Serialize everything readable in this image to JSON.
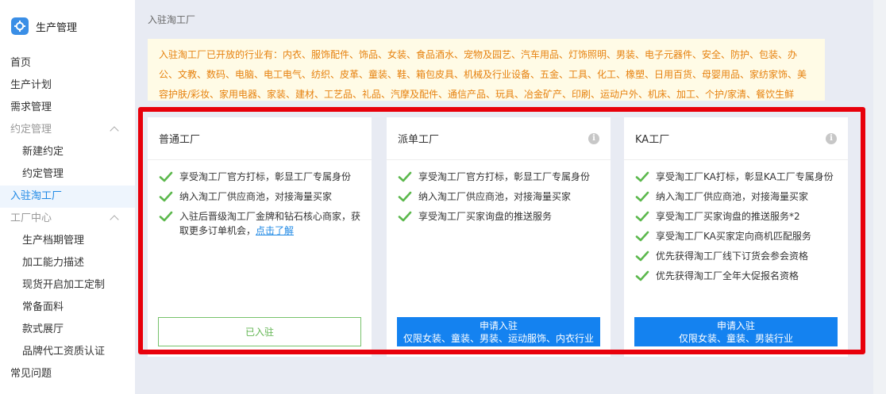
{
  "brand": {
    "title": "生产管理",
    "icon": "gear-icon"
  },
  "sidebar": {
    "items": [
      {
        "label": "首页"
      },
      {
        "label": "生产计划"
      },
      {
        "label": "需求管理"
      },
      {
        "label": "约定管理"
      },
      {
        "label": "新建约定"
      },
      {
        "label": "约定管理"
      },
      {
        "label": "入驻淘工厂"
      },
      {
        "label": "工厂中心"
      },
      {
        "label": "生产档期管理"
      },
      {
        "label": "加工能力描述"
      },
      {
        "label": "现货开启加工定制"
      },
      {
        "label": "常备面料"
      },
      {
        "label": "款式展厅"
      },
      {
        "label": "品牌代工资质认证"
      },
      {
        "label": "常见问题"
      }
    ]
  },
  "breadcrumb": "入驻淘工厂",
  "notice": "入驻淘工厂已开放的行业有：内衣、服饰配件、饰品、女装、食品酒水、宠物及园艺、汽车用品、灯饰照明、男装、电子元器件、安全、防护、包装、办公、文教、数码、电脑、电工电气、纺织、皮革、童装、鞋、箱包皮具、机械及行业设备、五金、工具、化工、橡塑、日用百货、母婴用品、家纺家饰、美容护肤/彩妆、家用电器、家装、建材、工艺品、礼品、汽摩及配件、通信产品、玩具、冶金矿产、印刷、运动户外、机床、加工、个护/家清、餐饮生鲜",
  "cards": [
    {
      "title": "普通工厂",
      "features": [
        "享受淘工厂官方打标，彰显工厂专属身份",
        "纳入淘工厂供应商池，对接海量买家",
        "入驻后晋级淘工厂金牌和钻石核心商家，获取更多订单机会，"
      ],
      "link": "点击了解",
      "button": {
        "line1": "已入驻",
        "line2": ""
      }
    },
    {
      "title": "派单工厂",
      "features": [
        "享受淘工厂官方打标，彰显工厂专属身份",
        "纳入淘工厂供应商池，对接海量买家",
        "享受淘工厂买家询盘的推送服务"
      ],
      "button": {
        "line1": "申请入驻",
        "line2": "仅限女装、童装、男装、运动服饰、内衣行业"
      }
    },
    {
      "title": "KA工厂",
      "features": [
        "享受淘工厂KA打标，彰显KA工厂专属身份",
        "纳入淘工厂供应商池，对接海量买家",
        "享受淘工厂买家询盘的推送服务*2",
        "享受淘工厂KA买家定向商机匹配服务",
        "优先获得淘工厂线下订货会参会资格",
        "优先获得淘工厂全年大促报名资格"
      ],
      "button": {
        "line1": "申请入驻",
        "line2": "仅限女装、童装、男装行业"
      }
    }
  ],
  "colors": {
    "accent": "#1482f0",
    "check": "#5cb84d",
    "highlight": "#e8000b",
    "notice_text": "#e6810e"
  }
}
